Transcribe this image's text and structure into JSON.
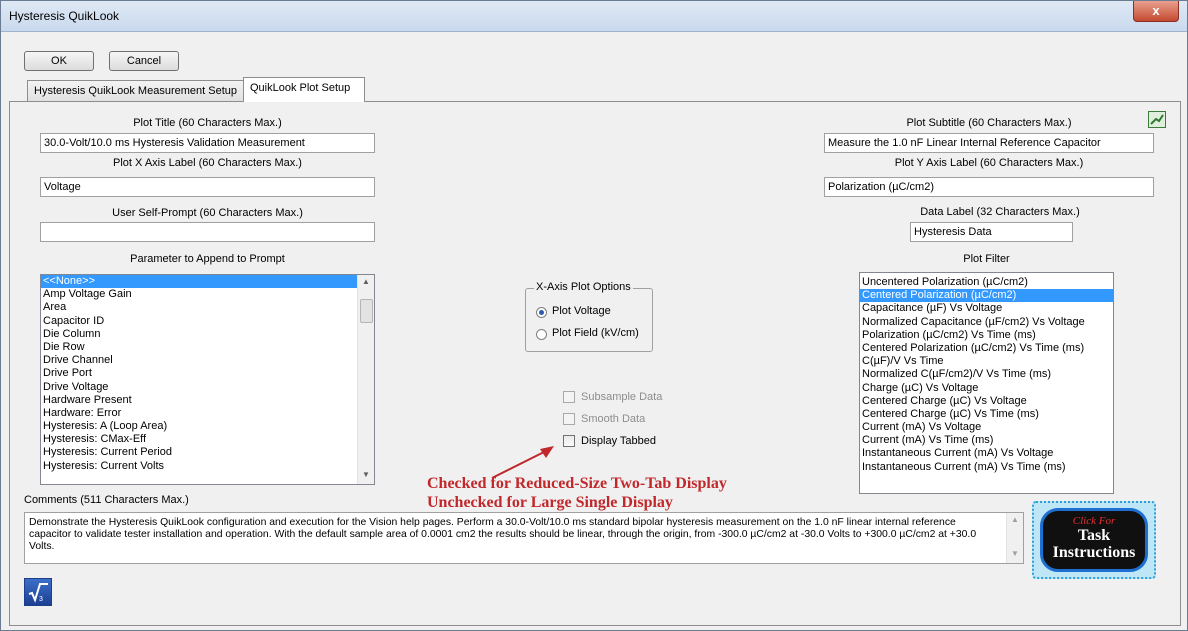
{
  "window": {
    "title": "Hysteresis QuikLook",
    "close_glyph": "x"
  },
  "toolbar": {
    "ok_label": "OK",
    "cancel_label": "Cancel"
  },
  "tabs": [
    {
      "label": "Hysteresis QuikLook Measurement Setup",
      "active": false
    },
    {
      "label": "QuikLook Plot Setup",
      "active": true
    }
  ],
  "fields": {
    "plot_title": {
      "label": "Plot Title (60 Characters Max.)",
      "value": "30.0-Volt/10.0 ms Hysteresis Validation Measurement"
    },
    "plot_subtitle": {
      "label": "Plot Subtitle (60 Characters Max.)",
      "value": "Measure the 1.0 nF Linear Internal Reference Capacitor"
    },
    "x_axis_label": {
      "label": "Plot X Axis Label (60 Characters Max.)",
      "value": "Voltage"
    },
    "y_axis_label": {
      "label": "Plot Y Axis Label (60 Characters Max.)",
      "value": "Polarization (µC/cm2)"
    },
    "self_prompt": {
      "label": "User Self-Prompt (60 Characters Max.)",
      "value": ""
    },
    "data_label": {
      "label": "Data Label (32 Characters Max.)",
      "value": "Hysteresis Data"
    }
  },
  "param_list": {
    "label": "Parameter to Append to Prompt",
    "items": [
      "<<None>>",
      "Amp Voltage Gain",
      "Area",
      "Capacitor ID",
      "Die Column",
      "Die Row",
      "Drive Channel",
      "Drive Port",
      "Drive Voltage",
      "Hardware Present",
      "Hardware: Error",
      "Hysteresis: A (Loop Area)",
      "Hysteresis: CMax-Eff",
      "Hysteresis: Current Period",
      "Hysteresis: Current Volts"
    ],
    "selected_index": 0
  },
  "x_axis_options": {
    "title": "X-Axis Plot Options",
    "options": [
      "Plot Voltage",
      "Plot Field (kV/cm)"
    ],
    "selected_index": 0
  },
  "checkboxes": [
    {
      "label": "Subsample Data",
      "checked": false,
      "enabled": false
    },
    {
      "label": "Smooth Data",
      "checked": false,
      "enabled": false
    },
    {
      "label": "Display Tabbed",
      "checked": false,
      "enabled": true
    }
  ],
  "plot_filter": {
    "label": "Plot Filter",
    "items": [
      "Uncentered Polarization (µC/cm2)",
      "Centered Polarization (µC/cm2)",
      "Capacitance (µF) Vs Voltage",
      "Normalized Capacitance (µF/cm2) Vs Voltage",
      "Polarization (µC/cm2) Vs Time (ms)",
      "Centered Polarization (µC/cm2) Vs Time (ms)",
      "C(µF)/V Vs Time",
      "Normalized C(µF/cm2)/V Vs Time (ms)",
      "Charge (µC) Vs Voltage",
      "Centered Charge (µC) Vs Voltage",
      "Centered Charge (µC) Vs Time (ms)",
      "Current (mA) Vs Voltage",
      "Current (mA) Vs Time (ms)",
      "Instantaneous Current (mA) Vs Voltage",
      "Instantaneous Current (mA) Vs Time (ms)"
    ],
    "selected_index": 1
  },
  "annotation": {
    "line1": "Checked for Reduced-Size Two-Tab Display",
    "line2": "Unchecked for Large Single Display"
  },
  "comments": {
    "label": "Comments (511 Characters Max.)",
    "value": "Demonstrate the Hysteresis QuikLook configuration and execution for the Vision help pages. Perform a 30.0-Volt/10.0 ms standard bipolar hysteresis measurement on the 1.0 nF linear internal reference capacitor to validate tester installation and operation. With the default sample area of 0.0001 cm2 the results should be linear, through the origin, from -300.0 µC/cm2 at -30.0 Volts to +300.0 µC/cm2 at +30.0 Volts."
  },
  "task_button": {
    "line1": "Click For",
    "line2": "Task",
    "line3": "Instructions"
  },
  "icons": {
    "corner_icon": "excel-chart-icon",
    "app_icon": "square-root-icon"
  },
  "colors": {
    "selection": "#3399ff",
    "annotation": "#c0282b",
    "close": "#c44a31"
  }
}
